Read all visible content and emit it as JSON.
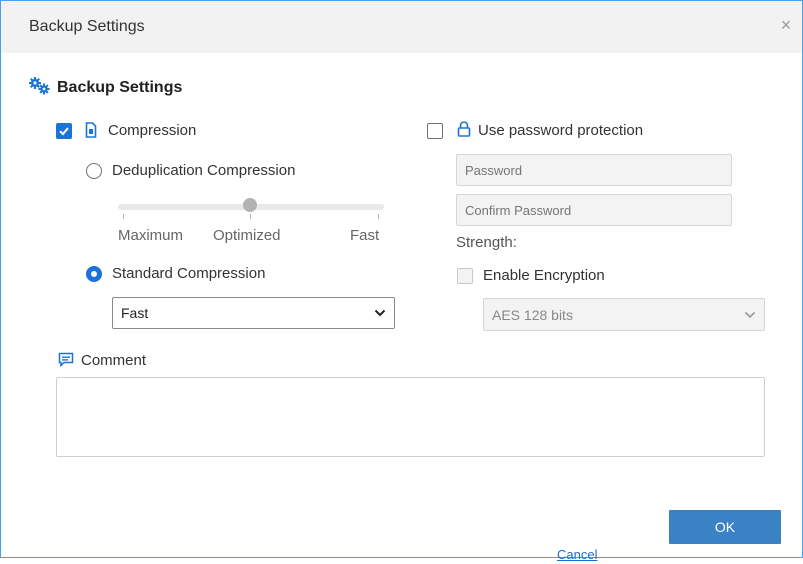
{
  "dialog": {
    "title": "Backup Settings",
    "close_glyph": "×"
  },
  "section": {
    "title": "Backup Settings",
    "icon": "gears-icon"
  },
  "compression": {
    "checked": true,
    "label": "Compression",
    "icon": "file-icon",
    "dedup": {
      "label": "Deduplication Compression",
      "selected": false,
      "slider": {
        "labels": [
          "Maximum",
          "Optimized",
          "Fast"
        ],
        "value_label": "Optimized"
      }
    },
    "standard": {
      "label": "Standard Compression",
      "selected": true,
      "select_value": "Fast"
    }
  },
  "password": {
    "checked": false,
    "label": "Use password protection",
    "icon": "lock-icon",
    "password_placeholder": "Password",
    "confirm_placeholder": "Confirm Password",
    "strength_label": "Strength:",
    "encryption": {
      "label": "Enable Encryption",
      "checked": false,
      "select_value": "AES 128 bits"
    }
  },
  "comment": {
    "label": "Comment",
    "icon": "comment-icon",
    "value": ""
  },
  "footer": {
    "cancel_label": "Cancel",
    "ok_label": "OK"
  },
  "colors": {
    "accent": "#1a73d9",
    "ok_button": "#3b82c4",
    "window_border": "#4aa0e6"
  }
}
